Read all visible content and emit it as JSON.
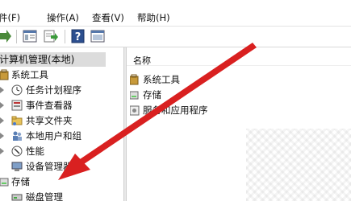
{
  "menu": {
    "file": "件(F)",
    "action": "操作(A)",
    "view": "查看(V)",
    "help": "帮助(H)"
  },
  "tree": {
    "root": "计算机管理(本地)",
    "system_tools": "系统工具",
    "task_scheduler": "任务计划程序",
    "event_viewer": "事件查看器",
    "shared_folders": "共享文件夹",
    "local_users": "本地用户和组",
    "performance": "性能",
    "device_manager": "设备管理器",
    "storage": "存储",
    "disk_management": "磁盘管理"
  },
  "list": {
    "column_name": "名称",
    "items": [
      "系统工具",
      "存储",
      "服务和应用程序"
    ]
  },
  "colors": {
    "annotation_arrow": "#d92020",
    "selection": "#dcdcdc",
    "divider": "#e9e9e9"
  },
  "icons": [
    "back-arrow-icon",
    "properties-icon",
    "export-icon",
    "help-icon",
    "show-hide-pane-icon",
    "computer-icon",
    "toolbox-icon",
    "clock-icon",
    "event-viewer-icon",
    "shared-folder-icon",
    "users-icon",
    "performance-icon",
    "device-manager-icon",
    "storage-icon",
    "disk-icon"
  ]
}
